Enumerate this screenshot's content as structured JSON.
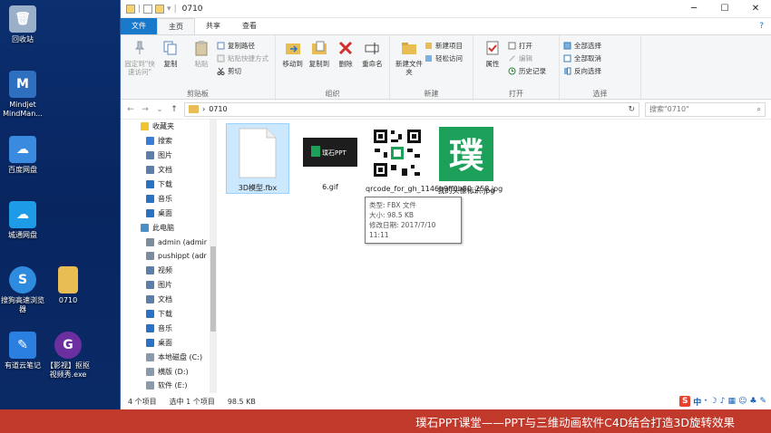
{
  "desktop": {
    "icons": [
      {
        "label": "回收站",
        "icon": "recycle-bin-icon",
        "color": "#9ab0c8"
      },
      {
        "label": "Mindjet MindMan...",
        "icon": "mindjet-icon",
        "color": "#2f6fc0"
      },
      {
        "label": "百度网盘",
        "icon": "baidu-netdisk-icon",
        "color": "#3a8be0"
      },
      {
        "label": "城通网盘",
        "icon": "ctdisk-icon",
        "color": "#1e9be6"
      },
      {
        "label": "搜狗高速浏览器",
        "icon": "sogou-browser-icon",
        "color": "#2f8bde"
      },
      {
        "label": "0710",
        "icon": "folder-icon",
        "color": "#e8bd53"
      },
      {
        "label": "有道云笔记",
        "icon": "youdao-note-icon",
        "color": "#2a7fe0"
      },
      {
        "label": "【影视】抠抠视频秀.exe",
        "icon": "kk-video-icon",
        "color": "#6b2fa0"
      }
    ]
  },
  "window": {
    "title": "0710",
    "controls": {
      "minimize": "─",
      "maximize": "☐",
      "close": "✕"
    },
    "tabs": {
      "file": "文件",
      "home": "主页",
      "share": "共享",
      "view": "查看"
    },
    "ribbon": {
      "clipboard": {
        "title": "剪贴板",
        "pin": "固定到\"快速访问\"",
        "copy": "复制",
        "paste": "粘贴",
        "copy_path": "复制路径",
        "paste_shortcut": "粘贴快捷方式",
        "cut": "剪切"
      },
      "organize": {
        "title": "组织",
        "move_to": "移动到",
        "copy_to": "复制到",
        "delete": "删除",
        "rename": "重命名"
      },
      "new": {
        "title": "新建",
        "new_folder": "新建文件夹",
        "new_item": "新建项目",
        "easy_access": "轻松访问"
      },
      "open": {
        "title": "打开",
        "properties": "属性",
        "open": "打开",
        "edit": "编辑",
        "history": "历史记录"
      },
      "select": {
        "title": "选择",
        "select_all": "全部选择",
        "select_none": "全部取消",
        "invert": "反向选择"
      }
    },
    "address": {
      "path": "0710",
      "search_placeholder": "搜索\"0710\""
    },
    "nav": [
      {
        "label": "收藏夹",
        "color": "#f0c330",
        "indent": 22
      },
      {
        "label": "搜索",
        "color": "#3a7bd5",
        "indent": 28
      },
      {
        "label": "图片",
        "color": "#5b7fa8",
        "indent": 28
      },
      {
        "label": "文档",
        "color": "#5b7fa8",
        "indent": 28
      },
      {
        "label": "下载",
        "color": "#2a73c4",
        "indent": 28
      },
      {
        "label": "音乐",
        "color": "#2a73c4",
        "indent": 28
      },
      {
        "label": "桌面",
        "color": "#2a73c4",
        "indent": 28
      },
      {
        "label": "此电脑",
        "color": "#4a90c8",
        "indent": 22
      },
      {
        "label": "admin (admir",
        "color": "#7c8c9c",
        "indent": 28
      },
      {
        "label": "pushippt (adr",
        "color": "#7c8c9c",
        "indent": 28
      },
      {
        "label": "视频",
        "color": "#5b7fa8",
        "indent": 28
      },
      {
        "label": "图片",
        "color": "#5b7fa8",
        "indent": 28
      },
      {
        "label": "文档",
        "color": "#5b7fa8",
        "indent": 28
      },
      {
        "label": "下载",
        "color": "#2a73c4",
        "indent": 28
      },
      {
        "label": "音乐",
        "color": "#2a73c4",
        "indent": 28
      },
      {
        "label": "桌面",
        "color": "#2a73c4",
        "indent": 28
      },
      {
        "label": "本地磁盘 (C:)",
        "color": "#8a9aa8",
        "indent": 28
      },
      {
        "label": "横版 (D:)",
        "color": "#8a9aa8",
        "indent": 28
      },
      {
        "label": "软件 (E:)",
        "color": "#8a9aa8",
        "indent": 28
      }
    ],
    "files": [
      {
        "name": "3D模型.fbx",
        "kind": "blank-doc"
      },
      {
        "name": "6.gif",
        "kind": "gif-thumb",
        "thumb_text": "璞石PPT"
      },
      {
        "name": "qrcode_for_gh_1146b9ff0b80_258.jpg",
        "kind": "qrcode"
      },
      {
        "name": "我的头像标识.jpg",
        "kind": "avatar",
        "thumb_text": "璞"
      }
    ],
    "tooltip": {
      "type": "类型: FBX 文件",
      "size": "大小: 98.5 KB",
      "modified": "修改日期: 2017/7/10 11:11"
    },
    "status": {
      "count": "4 个项目",
      "selected": "选中 1 个项目",
      "size": "98.5 KB"
    }
  },
  "ime": {
    "logo": "S",
    "items": [
      "中",
      "·",
      "☽",
      "♪",
      "▦",
      "☺",
      "♣",
      "✎"
    ]
  },
  "banner": {
    "text": "璞石PPT课堂——PPT与三维动画软件C4D结合打造3D旋转效果"
  },
  "colors": {
    "accent": "#1979ca",
    "banner": "#c0392b",
    "selection": "#cce8ff",
    "brand_green": "#1da15a"
  }
}
